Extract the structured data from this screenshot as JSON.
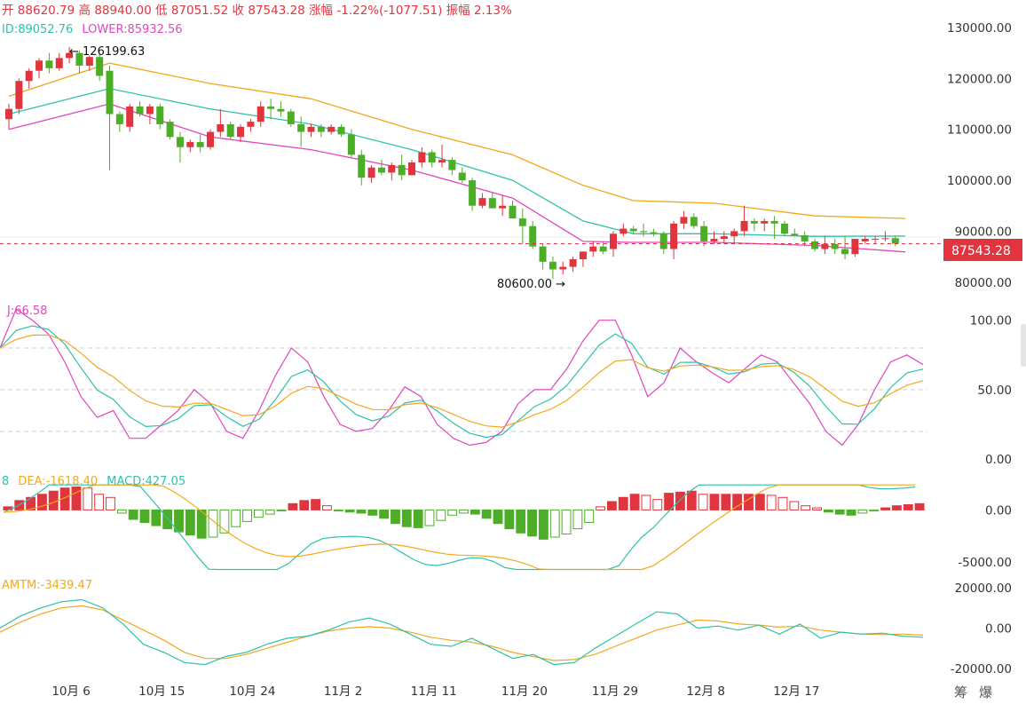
{
  "header": {
    "open_label": "开",
    "open": "88620.79",
    "high_label": "高",
    "high": "88940.00",
    "low_label": "低",
    "low": "87051.52",
    "close_label": "收",
    "close": "87543.28",
    "change_label": "涨幅",
    "change": "-1.22%(-1077.51)",
    "amplitude_label": "振幅",
    "amplitude": "2.13%"
  },
  "boll_legend": {
    "mid": "ID:89052.76",
    "lower": "LOWER:85932.56"
  },
  "annotations": {
    "high_marker": "← 126199.63",
    "low_marker": "80600.00 →"
  },
  "price_tag": "87543.28",
  "kdj_legend": {
    "j": "J:66.58"
  },
  "macd_legend": {
    "dif_tail": "8",
    "dea": "DEA:-1618.40",
    "macd": "MACD:427.05"
  },
  "mtm_legend": {
    "amtm": "AMTM:-3439.47"
  },
  "footer": {
    "btn1": "筹",
    "btn2": "爆"
  },
  "colors": {
    "up": "#e0343e",
    "down": "#4cae27",
    "mid": "#2cc3a9",
    "upper": "#f2a81d",
    "lower": "#e046bd"
  },
  "chart_data": [
    {
      "type": "candlestick",
      "title": "",
      "x_tick_labels": [
        "10月 6",
        "10月 15",
        "10月 24",
        "11月 2",
        "11月 11",
        "11月 20",
        "11月 29",
        "12月 8",
        "12月 17"
      ],
      "y_tick_labels": [
        "130000.00",
        "120000.00",
        "110000.00",
        "100000.00",
        "90000.00",
        "80000.00"
      ],
      "ylim": [
        77000,
        134000
      ],
      "candles": [
        [
          112000,
          115000,
          110000,
          114000
        ],
        [
          114000,
          120000,
          113000,
          119500
        ],
        [
          119500,
          122000,
          118000,
          121500
        ],
        [
          121500,
          124000,
          120000,
          123500
        ],
        [
          123500,
          125000,
          121000,
          122000
        ],
        [
          122000,
          125000,
          121500,
          124000
        ],
        [
          124000,
          126199.63,
          123000,
          125000
        ],
        [
          125000,
          125500,
          121000,
          122500
        ],
        [
          122500,
          124500,
          121500,
          124200
        ],
        [
          124200,
          125000,
          119500,
          120500
        ],
        [
          121500,
          122500,
          102000,
          113000
        ],
        [
          113000,
          113500,
          109500,
          111000
        ],
        [
          110500,
          115000,
          109500,
          114500
        ],
        [
          114500,
          115500,
          112500,
          113000
        ],
        [
          113000,
          115000,
          111000,
          114500
        ],
        [
          114500,
          115000,
          110000,
          111000
        ],
        [
          111500,
          112000,
          108000,
          108500
        ],
        [
          108500,
          109500,
          103500,
          106500
        ],
        [
          106500,
          108000,
          105500,
          107500
        ],
        [
          107500,
          109000,
          105500,
          106500
        ],
        [
          106500,
          110000,
          106000,
          109500
        ],
        [
          109500,
          114000,
          108500,
          111000
        ],
        [
          111000,
          111500,
          108000,
          108500
        ],
        [
          108500,
          111000,
          107500,
          110500
        ],
        [
          110500,
          112000,
          109500,
          111500
        ],
        [
          111500,
          115500,
          110500,
          114500
        ],
        [
          114500,
          116000,
          112000,
          114000
        ],
        [
          114000,
          115500,
          112500,
          113500
        ],
        [
          113500,
          114000,
          110500,
          111000
        ],
        [
          111000,
          112500,
          106500,
          109500
        ],
        [
          109500,
          111000,
          108500,
          110500
        ],
        [
          110500,
          111000,
          108500,
          109500
        ],
        [
          109500,
          111000,
          109000,
          110500
        ],
        [
          110500,
          111000,
          108500,
          109000
        ],
        [
          109000,
          110000,
          104500,
          105000
        ],
        [
          105000,
          106000,
          99000,
          100500
        ],
        [
          100500,
          103000,
          99500,
          102500
        ],
        [
          102500,
          104000,
          101000,
          101500
        ],
        [
          101500,
          103500,
          100000,
          103000
        ],
        [
          103000,
          105000,
          100000,
          101000
        ],
        [
          101000,
          104000,
          101000,
          103500
        ],
        [
          103500,
          106500,
          102500,
          105500
        ],
        [
          105500,
          106000,
          102500,
          103500
        ],
        [
          103500,
          107000,
          102500,
          104000
        ],
        [
          104000,
          104500,
          101000,
          102000
        ],
        [
          101500,
          102500,
          99500,
          100000
        ],
        [
          100000,
          100500,
          94000,
          95000
        ],
        [
          95000,
          97500,
          94500,
          96500
        ],
        [
          96500,
          97500,
          94500,
          94500
        ],
        [
          94500,
          97000,
          93000,
          95000
        ],
        [
          95000,
          96000,
          92500,
          92500
        ],
        [
          92500,
          94500,
          87500,
          91000
        ],
        [
          91000,
          92000,
          86500,
          87000
        ],
        [
          87000,
          87500,
          82500,
          84000
        ],
        [
          84000,
          85000,
          80600,
          82500
        ],
        [
          82500,
          84000,
          81500,
          83000
        ],
        [
          83000,
          85000,
          82000,
          84500
        ],
        [
          84500,
          86000,
          83000,
          86000
        ],
        [
          86000,
          88000,
          85000,
          87000
        ],
        [
          87000,
          88000,
          85500,
          86000
        ],
        [
          86500,
          90000,
          85000,
          89500
        ],
        [
          89500,
          91500,
          89000,
          90500
        ],
        [
          90500,
          91000,
          89500,
          90000
        ],
        [
          90000,
          91500,
          89000,
          89800
        ],
        [
          89800,
          90500,
          89000,
          89600
        ],
        [
          89600,
          90000,
          85500,
          86500
        ],
        [
          86500,
          92000,
          84500,
          91500
        ],
        [
          91500,
          94000,
          90500,
          92800
        ],
        [
          92800,
          93500,
          90500,
          91000
        ],
        [
          91000,
          92000,
          87000,
          88000
        ],
        [
          88000,
          90000,
          87500,
          88500
        ],
        [
          88500,
          90000,
          87500,
          89000
        ],
        [
          89000,
          90500,
          87500,
          90000
        ],
        [
          90000,
          95000,
          89000,
          92000
        ],
        [
          92000,
          92500,
          90000,
          91500
        ],
        [
          91500,
          92500,
          90000,
          92000
        ],
        [
          92000,
          93000,
          88500,
          91500
        ],
        [
          91500,
          92000,
          89000,
          89500
        ],
        [
          89500,
          90500,
          89000,
          89200
        ],
        [
          89200,
          90000,
          87000,
          88000
        ],
        [
          88000,
          88500,
          86000,
          86500
        ],
        [
          86500,
          89000,
          85500,
          87500
        ],
        [
          87500,
          88500,
          85500,
          86500
        ],
        [
          86500,
          89000,
          84500,
          85500
        ],
        [
          85500,
          88500,
          85000,
          88500
        ],
        [
          88000,
          89000,
          87500,
          88500
        ],
        [
          88500,
          89000,
          87500,
          88500
        ],
        [
          88500,
          90000,
          88000,
          88620.79
        ],
        [
          88620.79,
          88940,
          87051.52,
          87543.28
        ]
      ],
      "bands": {
        "upper": [
          [
            0,
            116500
          ],
          [
            10,
            123000
          ],
          [
            20,
            119000
          ],
          [
            30,
            116000
          ],
          [
            40,
            110000
          ],
          [
            50,
            105000
          ],
          [
            57,
            99000
          ],
          [
            62,
            96000
          ],
          [
            70,
            95500
          ],
          [
            80,
            93000
          ],
          [
            89,
            92500
          ]
        ],
        "mid": [
          [
            0,
            113000
          ],
          [
            10,
            118000
          ],
          [
            20,
            114000
          ],
          [
            30,
            111000
          ],
          [
            40,
            106000
          ],
          [
            50,
            100000
          ],
          [
            57,
            92000
          ],
          [
            62,
            89500
          ],
          [
            70,
            89500
          ],
          [
            80,
            89000
          ],
          [
            89,
            89052.76
          ]
        ],
        "lower": [
          [
            0,
            110000
          ],
          [
            10,
            115000
          ],
          [
            20,
            108500
          ],
          [
            30,
            106000
          ],
          [
            40,
            102000
          ],
          [
            50,
            96500
          ],
          [
            57,
            88000
          ],
          [
            62,
            87800
          ],
          [
            70,
            87800
          ],
          [
            80,
            87200
          ],
          [
            89,
            85932.56
          ]
        ]
      }
    },
    {
      "type": "line",
      "title": "KDJ",
      "y_tick_labels": [
        "100.00",
        "50.00",
        "0.00"
      ],
      "ylim": [
        -5,
        110
      ],
      "series": [
        {
          "name": "J",
          "values": [
            80,
            108,
            100,
            90,
            70,
            45,
            30,
            35,
            15,
            15,
            25,
            35,
            50,
            40,
            20,
            15,
            35,
            60,
            80,
            70,
            45,
            25,
            20,
            22,
            35,
            52,
            45,
            25,
            15,
            10,
            12,
            20,
            40,
            50,
            50,
            65,
            85,
            100,
            100,
            75,
            45,
            55,
            80,
            70,
            62,
            55,
            65,
            75,
            70,
            55,
            40,
            20,
            10,
            25,
            50,
            70,
            75,
            68
          ]
        }
      ]
    },
    {
      "type": "bar",
      "title": "MACD",
      "y_tick_labels": [
        "0.00",
        "-5000.00"
      ],
      "ylim": [
        -6000,
        2500
      ],
      "series": [
        {
          "name": "MACD",
          "values": [
            300,
            900,
            1200,
            1500,
            1800,
            2100,
            2200,
            2100,
            1500,
            1200,
            -300,
            -900,
            -1200,
            -1500,
            -1800,
            -2100,
            -2400,
            -2700,
            -2600,
            -2200,
            -1600,
            -1100,
            -700,
            -400,
            -100,
            600,
            900,
            1000,
            400,
            -100,
            -200,
            -300,
            -500,
            -800,
            -1300,
            -1600,
            -1700,
            -1500,
            -1000,
            -500,
            -300,
            -400,
            -800,
            -1300,
            -1800,
            -2200,
            -2500,
            -2800,
            -2600,
            -2300,
            -1800,
            -1200,
            300,
            800,
            1200,
            1500,
            1400,
            1000,
            1600,
            1700,
            1800,
            1500,
            1500,
            1500,
            1500,
            1500,
            1500,
            1400,
            1200,
            800,
            400,
            200,
            -200,
            -400,
            -500,
            -300,
            -100,
            200,
            400,
            500,
            600
          ]
        }
      ]
    },
    {
      "type": "line",
      "title": "MTM",
      "y_tick_labels": [
        "20000.00",
        "0.00",
        "-20000.00"
      ],
      "ylim": [
        -23000,
        23000
      ],
      "series": [
        {
          "name": "AMTM",
          "values": [
            -2000,
            3000,
            7000,
            10000,
            11000,
            9000,
            4000,
            -1000,
            -6000,
            -12000,
            -15000,
            -15000,
            -13000,
            -10000,
            -7000,
            -4000,
            -1500,
            0,
            700,
            0,
            -2000,
            -4500,
            -6000,
            -7000,
            -9000,
            -12000,
            -14000,
            -16000,
            -15500,
            -13000,
            -9000,
            -5000,
            -1000,
            1500,
            4000,
            3500,
            2000,
            1500,
            500,
            1000,
            -1000,
            -2000,
            -3000,
            -3200,
            -3000,
            -3439.47
          ]
        },
        {
          "name": "MTM",
          "values": [
            0,
            6000,
            10000,
            13000,
            14000,
            10000,
            2000,
            -8000,
            -12000,
            -17000,
            -18000,
            -14000,
            -12000,
            -8000,
            -5000,
            -4000,
            -1000,
            3000,
            5000,
            2000,
            -3000,
            -8000,
            -9000,
            -5000,
            -10000,
            -15000,
            -13000,
            -18000,
            -17000,
            -10000,
            -4000,
            2000,
            8000,
            7000,
            0,
            1000,
            -1000,
            1500,
            -3000,
            2000,
            -5000,
            -2000,
            -3000,
            -2500,
            -4000,
            -4500
          ]
        }
      ]
    }
  ]
}
